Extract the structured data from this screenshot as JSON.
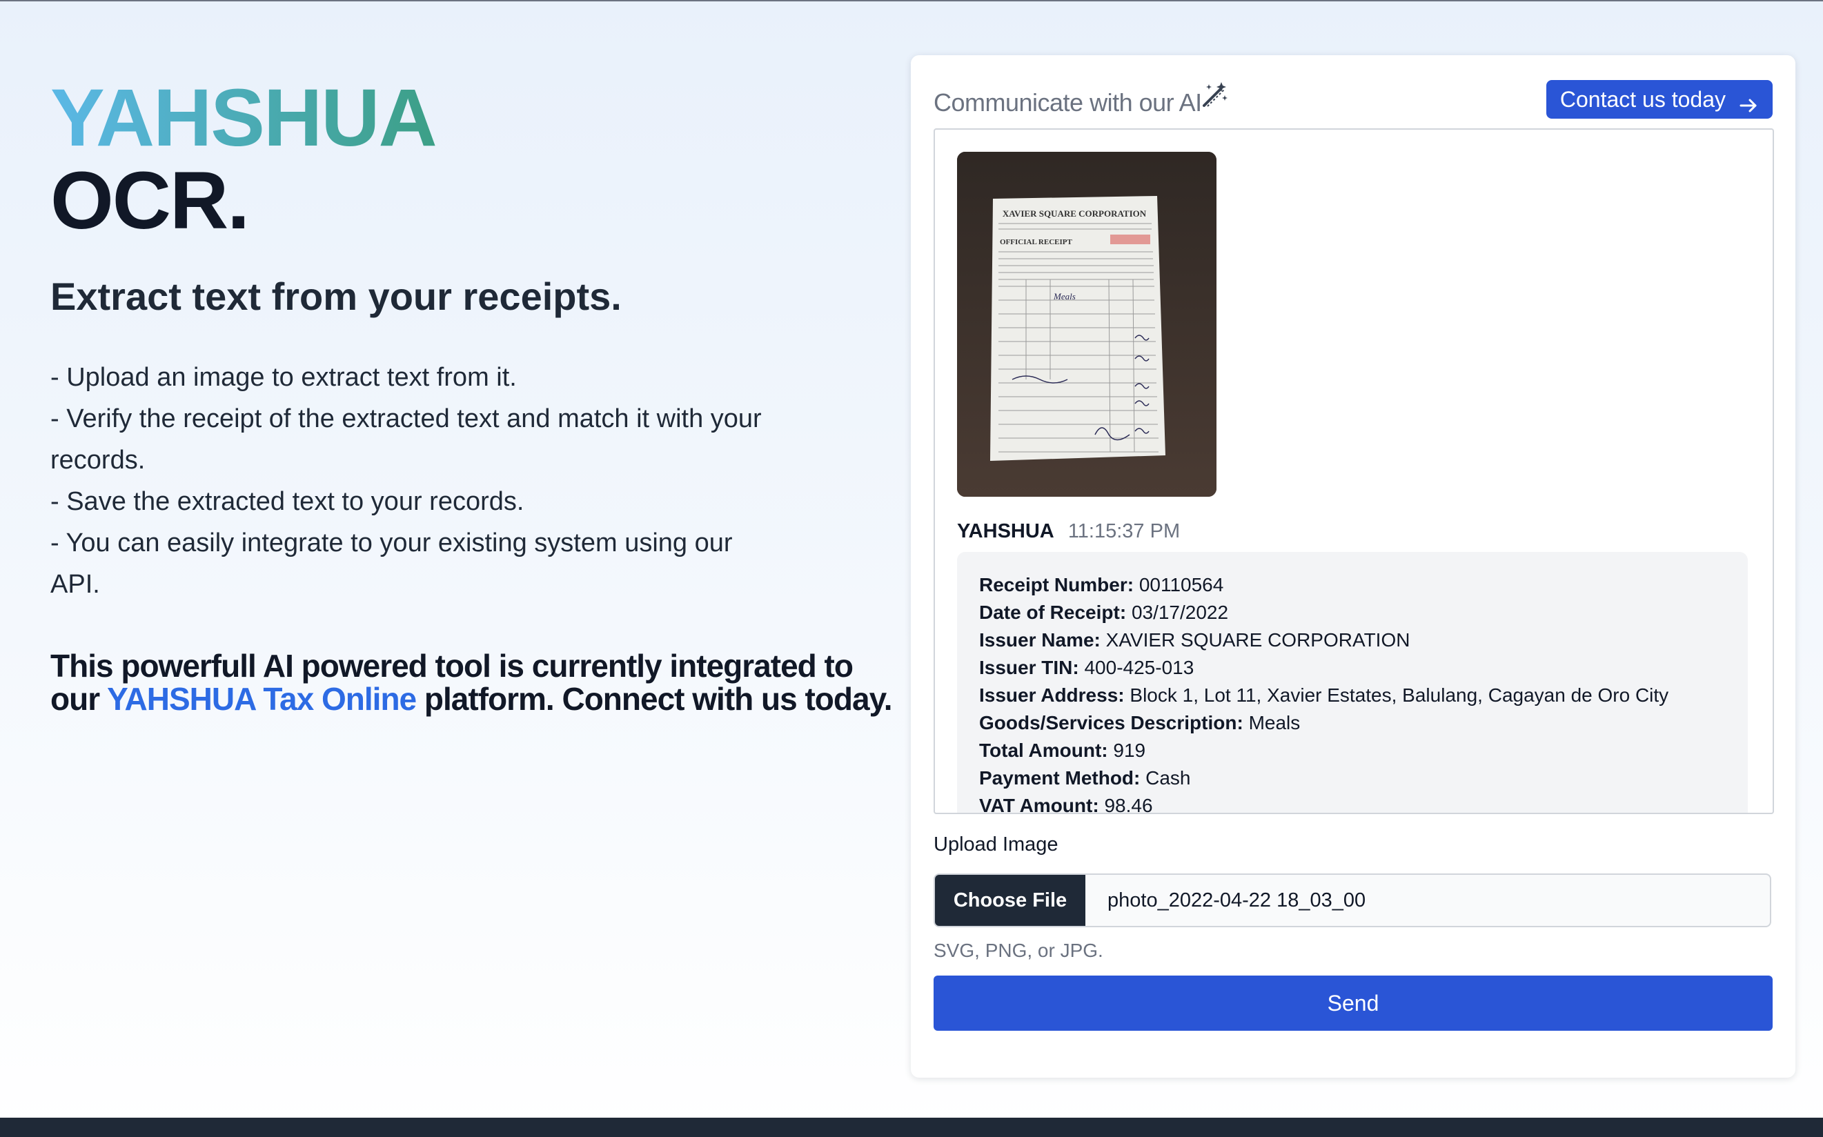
{
  "brand": {
    "name": "YAHSHUA",
    "product": "OCR."
  },
  "tagline": "Extract text from your receipts.",
  "features": [
    "- Upload an image to extract text from it.",
    "- Verify the receipt of the extracted text and match it with your records.",
    "- Save the extracted text to your records.",
    "- You can easily integrate to your existing system using our API."
  ],
  "promo": {
    "before": "This powerfull AI powered tool is currently integrated to our ",
    "link": "YAHSHUA Tax Online",
    "after": " platform. Connect with us today."
  },
  "chat": {
    "title": "Communicate with our AI",
    "contact_label": "Contact us today",
    "receipt_image": {
      "company": "XAVIER SQUARE CORPORATION",
      "doc_type": "OFFICIAL RECEIPT",
      "item": "Meals"
    },
    "message": {
      "sender": "YAHSHUA",
      "time": "11:15:37 PM",
      "fields": [
        {
          "label": "Receipt Number:",
          "value": "00110564"
        },
        {
          "label": "Date of Receipt:",
          "value": "03/17/2022"
        },
        {
          "label": "Issuer Name:",
          "value": "XAVIER SQUARE CORPORATION"
        },
        {
          "label": "Issuer TIN:",
          "value": "400-425-013"
        },
        {
          "label": "Issuer Address:",
          "value": "Block 1, Lot 11, Xavier Estates, Balulang, Cagayan de Oro City"
        },
        {
          "label": "Goods/Services Description:",
          "value": "Meals"
        },
        {
          "label": "Total Amount:",
          "value": "919"
        },
        {
          "label": "Payment Method:",
          "value": "Cash"
        },
        {
          "label": "VAT Amount:",
          "value": "98.46"
        }
      ]
    }
  },
  "upload": {
    "label": "Upload Image",
    "choose_label": "Choose File",
    "file_name": "photo_2022-04-22 18_03_00",
    "hint": "SVG, PNG, or JPG.",
    "send_label": "Send"
  },
  "colors": {
    "accent": "#2a55d6",
    "link": "#2d6be4",
    "brand_gradient_start": "#5bb8e6",
    "brand_gradient_end": "#3c9f86",
    "dark": "#1f2937"
  }
}
